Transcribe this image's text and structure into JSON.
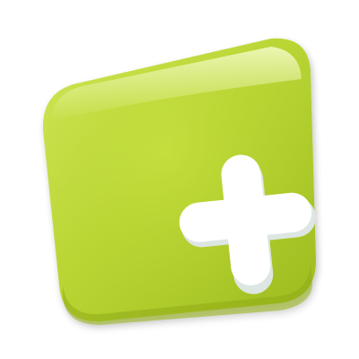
{
  "logo": {
    "icon": "plus-square-icon",
    "colors": {
      "background": "#ffffff",
      "tile_light": "#d5ea60",
      "tile_main": "#b9d634",
      "tile_dark": "#9dbb1f",
      "tile_shadow": "#7f9a12",
      "highlight": "#eef7b8",
      "plus": "#ffffff",
      "plus_shadow": "#dde6e3"
    }
  }
}
